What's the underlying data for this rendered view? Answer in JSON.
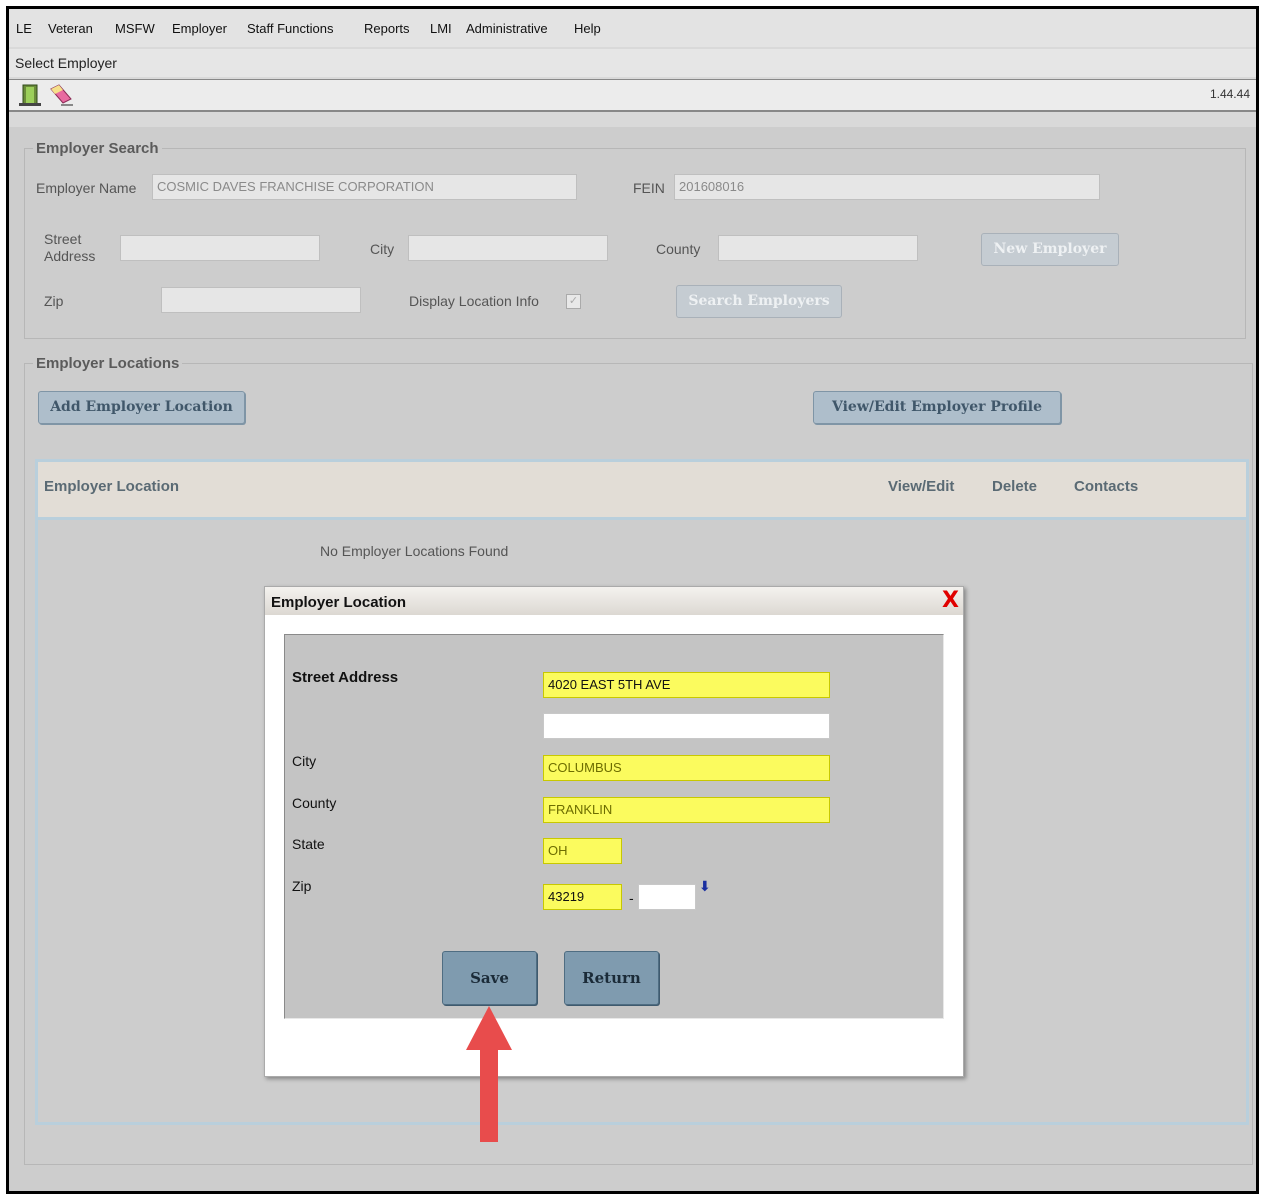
{
  "menu": [
    "LE",
    "Veteran",
    "MSFW",
    "Employer",
    "Staff Functions",
    "Reports",
    "LMI",
    "Administrative",
    "Help"
  ],
  "window": {
    "title": "Select Employer",
    "version": "1.44.44"
  },
  "toolbar": {
    "icons": [
      "exit-door-icon",
      "eraser-icon"
    ]
  },
  "employer_search": {
    "legend": "Employer Search",
    "employer_name_label": "Employer Name",
    "employer_name_value": "COSMIC DAVES FRANCHISE CORPORATION",
    "fein_label": "FEIN",
    "fein_value": "201608016",
    "street_label_1": "Street",
    "street_label_2": "Address",
    "city_label": "City",
    "county_label": "County",
    "zip_label": "Zip",
    "display_location_label": "Display Location Info",
    "display_location_checked": true,
    "new_employer_button": "New Employer",
    "search_button": "Search Employers"
  },
  "employer_locations": {
    "legend": "Employer Locations",
    "add_button": "Add Employer Location",
    "profile_button": "View/Edit Employer Profile",
    "columns": [
      "Employer Location",
      "View/Edit",
      "Delete",
      "Contacts"
    ],
    "empty_message": "No Employer Locations Found"
  },
  "modal": {
    "title": "Employer Location",
    "close_glyph": "X",
    "street_label": "Street Address",
    "street_value": "4020 EAST 5TH AVE",
    "street2_value": "",
    "city_label": "City",
    "city_value": "COLUMBUS",
    "county_label": "County",
    "county_value": "FRANKLIN",
    "state_label": "State",
    "state_value": "OH",
    "zip_label": "Zip",
    "zip_value": "43219",
    "zip_dash": "-",
    "zip4_value": "",
    "zip_lookup_glyph": "⬇",
    "save_button": "Save",
    "return_button": "Return"
  },
  "colors": {
    "required_field": "#fbfb5e",
    "annotation_arrow": "#e84c4c",
    "close_x": "#e00000"
  }
}
